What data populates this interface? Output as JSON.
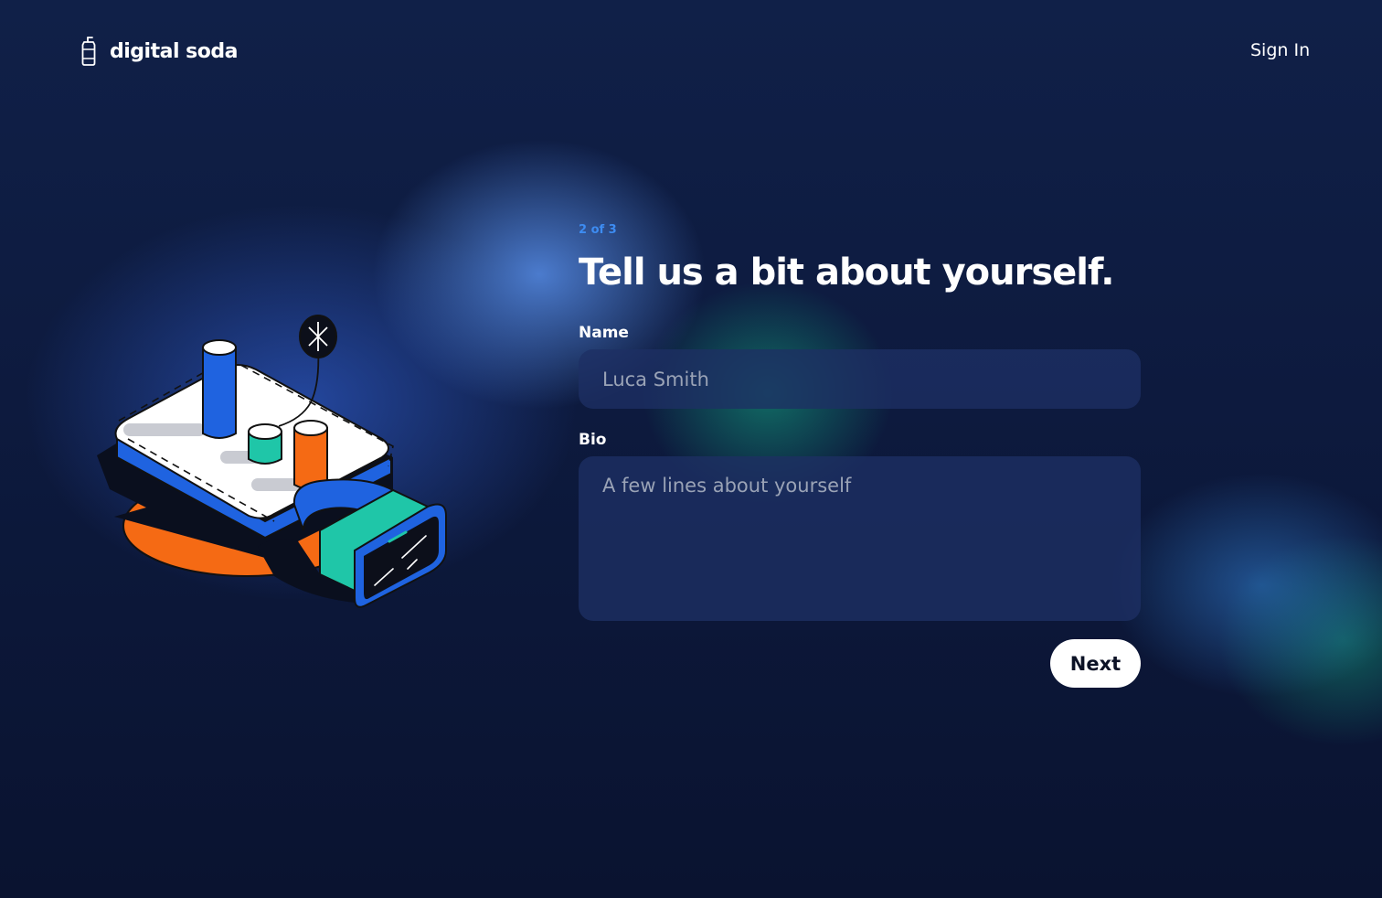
{
  "header": {
    "logo_text": "digital soda",
    "logo_icon": "soda-can-icon",
    "signin_label": "Sign In"
  },
  "form": {
    "step_text": "2 of 3",
    "title": "Tell us a bit about yourself.",
    "name_label": "Name",
    "name_placeholder": "Luca Smith",
    "bio_label": "Bio",
    "bio_placeholder": "A few lines about yourself",
    "next_label": "Next"
  },
  "illustration": {
    "icon": "vr-headset-dashboard-illustration"
  },
  "colors": {
    "background": "#0c1530",
    "accent_blue": "#3d8cf2",
    "button_bg": "#ffffff",
    "field_bg": "#1e3064",
    "placeholder": "#9aa3b6",
    "illustration_blue": "#1f63e0",
    "illustration_teal": "#1fc6a8",
    "illustration_orange": "#f56a14"
  }
}
